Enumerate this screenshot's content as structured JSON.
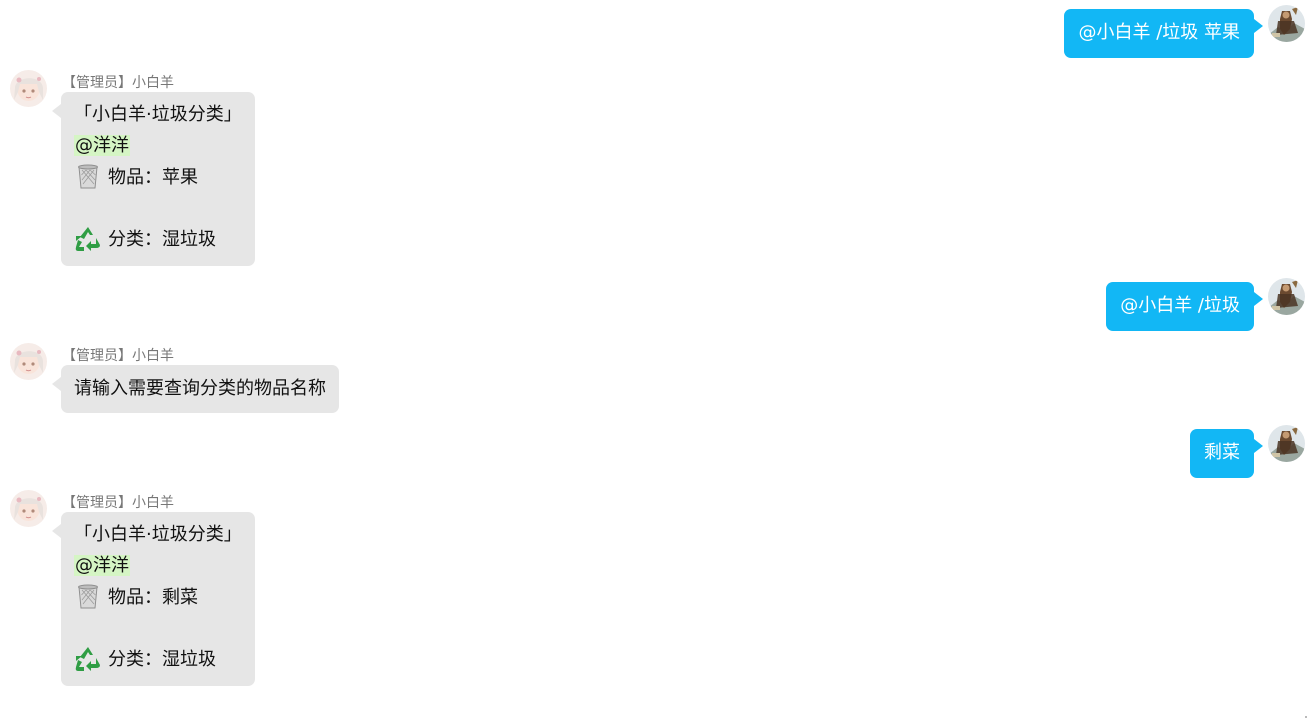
{
  "bot": {
    "sender": "【管理员】小白羊"
  },
  "messages": [
    {
      "side": "out",
      "text": "@小白羊 /垃圾 苹果"
    },
    {
      "side": "in",
      "header": "「小白羊·垃圾分类」",
      "mention": "@洋洋",
      "item_label": "物品：苹果",
      "category_label": "分类：湿垃圾"
    },
    {
      "side": "out",
      "text": "@小白羊 /垃圾"
    },
    {
      "side": "in",
      "text": "请输入需要查询分类的物品名称"
    },
    {
      "side": "out",
      "text": "剩菜"
    },
    {
      "side": "in",
      "header": "「小白羊·垃圾分类」",
      "mention": "@洋洋",
      "item_label": "物品：剩菜",
      "category_label": "分类：湿垃圾"
    }
  ],
  "icons": {
    "item_icon": "wastebasket-icon",
    "category_icon": "recycle-icon"
  },
  "colors": {
    "outgoing_bubble": "#12b7f5",
    "incoming_bubble": "#e6e6e6",
    "mention_highlight": "#d5f5c4",
    "sender_text": "#777777"
  }
}
